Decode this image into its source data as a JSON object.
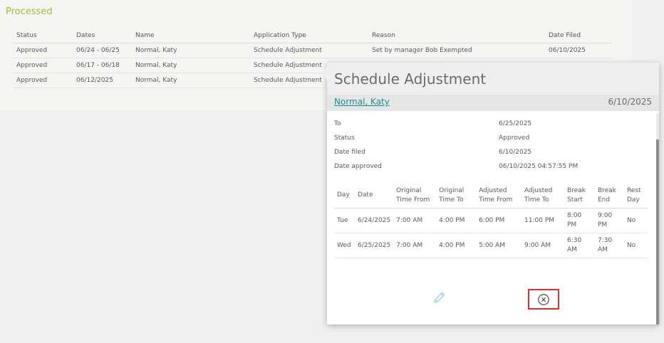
{
  "section": {
    "title": "Processed"
  },
  "table": {
    "columns": [
      "Status",
      "Dates",
      "Name",
      "Application Type",
      "Reason",
      "Date Filed"
    ],
    "rows": [
      [
        "Approved",
        "06/24 - 06/25",
        "Normal, Katy",
        "Schedule Adjustment",
        "Set by manager Bob Exempted",
        "06/10/2025"
      ],
      [
        "Approved",
        "06/17 - 06/18",
        "Normal, Katy",
        "Schedule Adjustment",
        "",
        ""
      ],
      [
        "Approved",
        "06/12/2025",
        "Normal, Katy",
        "Schedule Adjustment",
        "",
        ""
      ]
    ]
  },
  "popup": {
    "title": "Schedule Adjustment",
    "employee_name": "Normal, Katy",
    "filed_date": "6/10/2025",
    "details": [
      {
        "label": "To",
        "value": "6/25/2025"
      },
      {
        "label": "Status",
        "value": "Approved"
      },
      {
        "label": "Date filed",
        "value": "6/10/2025"
      },
      {
        "label": "Date approved",
        "value": "06/10/2025 04:57:55 PM"
      }
    ],
    "schedule": {
      "headers": [
        "Day",
        "Date",
        "Original Time From",
        "Original Time To",
        "Adjusted Time From",
        "Adjusted Time To",
        "Break Start",
        "Break End",
        "Rest Day"
      ],
      "rows": [
        [
          "Tue",
          "6/24/2025",
          "7:00 AM",
          "4:00 PM",
          "6:00 PM",
          "11:00 PM",
          "8:00 PM",
          "9:00 PM",
          "No"
        ],
        [
          "Wed",
          "6/25/2025",
          "7:00 AM",
          "4:00 PM",
          "5:00 AM",
          "9:00 AM",
          "6:30 AM",
          "7:30 AM",
          "No"
        ]
      ]
    },
    "icons": {
      "edit": "pencil-icon",
      "close": "close-circle-icon"
    },
    "colors": {
      "accent": "#9fbc3c",
      "link": "#1d8f8a",
      "highlight": "#d9302c"
    }
  }
}
